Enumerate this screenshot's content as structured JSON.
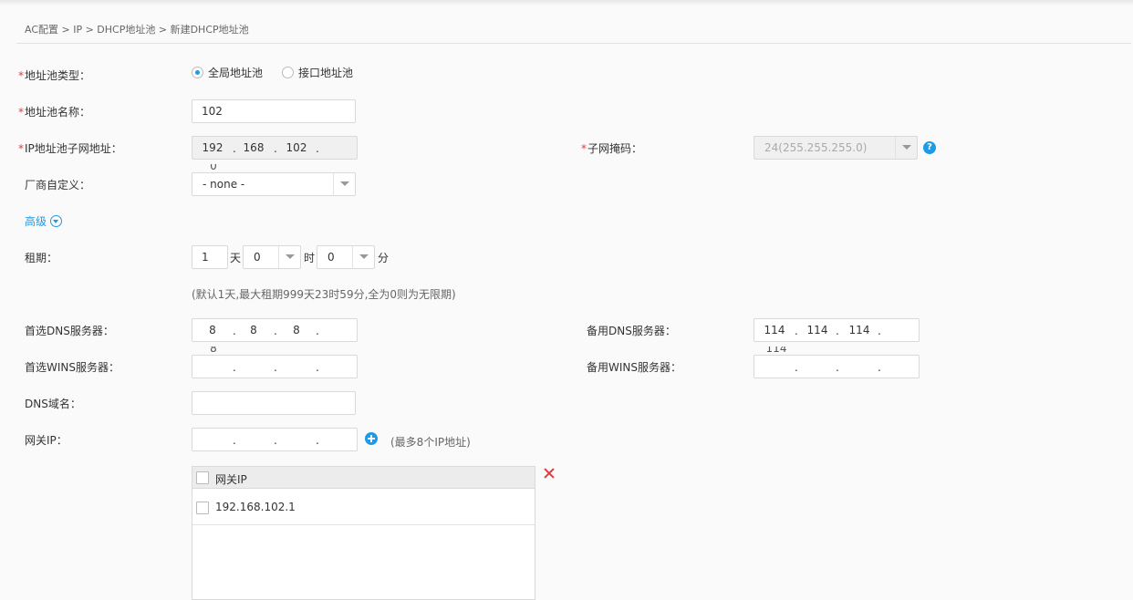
{
  "breadcrumb": "AC配置 > IP > DHCP地址池 > 新建DHCP地址池",
  "required_mark": "*",
  "pool_type": {
    "label": "地址池类型：",
    "options": [
      "全局地址池",
      "接口地址池"
    ],
    "selected": "全局地址池"
  },
  "pool_name": {
    "label": "地址池名称：",
    "value": "102"
  },
  "subnet": {
    "label": "IP地址池子网地址：",
    "octets": [
      "192",
      "168",
      "102",
      "0"
    ]
  },
  "mask": {
    "label": "子网掩码：",
    "value": "24(255.255.255.0)",
    "help": "?"
  },
  "vendor": {
    "label": "厂商自定义：",
    "value": "- none -"
  },
  "advanced": {
    "label": "高级"
  },
  "lease": {
    "label": "租期：",
    "days": "1",
    "days_unit": "天",
    "hours": "0",
    "hours_unit": "时",
    "minutes": "0",
    "minutes_unit": "分",
    "hint": "(默认1天,最大租期999天23时59分,全为0则为无限期)"
  },
  "primary_dns": {
    "label": "首选DNS服务器：",
    "octets": [
      "8",
      "8",
      "8",
      "8"
    ]
  },
  "backup_dns": {
    "label": "备用DNS服务器：",
    "octets": [
      "114",
      "114",
      "114",
      "114"
    ]
  },
  "primary_wins": {
    "label": "首选WINS服务器：",
    "octets": [
      "",
      "",
      "",
      ""
    ]
  },
  "backup_wins": {
    "label": "备用WINS服务器：",
    "octets": [
      "",
      "",
      "",
      ""
    ]
  },
  "dns_domain": {
    "label": "DNS域名：",
    "value": ""
  },
  "gateway": {
    "label": "网关IP：",
    "octets": [
      "",
      "",
      "",
      ""
    ],
    "hint": "(最多8个IP地址)",
    "table": {
      "header": "网关IP",
      "rows": [
        "192.168.102.1"
      ]
    }
  },
  "colors": {
    "accent": "#1e9be8",
    "required": "#e4393c"
  }
}
